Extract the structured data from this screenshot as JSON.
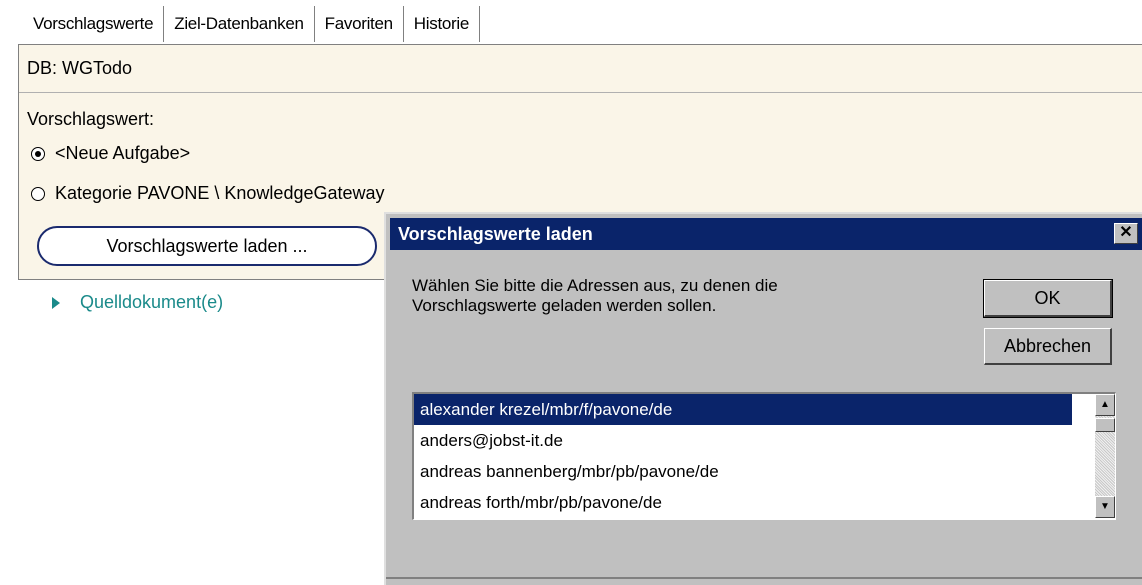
{
  "tabs": [
    "Vorschlagswerte",
    "Ziel-Datenbanken",
    "Favoriten",
    "Historie"
  ],
  "panel": {
    "db_label": "DB: WGTodo",
    "vorschlagswert_label": "Vorschlagswert:",
    "radio_options": [
      "<Neue Aufgabe>",
      "Kategorie PAVONE \\ KnowledgeGateway"
    ],
    "selected_option": "<Neue Aufgabe>",
    "load_button": "Vorschlagswerte laden ..."
  },
  "quell_link": "Quelldokument(e)",
  "dialog": {
    "title": "Vorschlagswerte laden",
    "close_glyph": "✕",
    "message_line1": "Wählen Sie bitte die Adressen aus, zu denen die",
    "message_line2": "Vorschlagswerte geladen werden sollen.",
    "ok_label": "OK",
    "cancel_label": "Abbrechen",
    "list_items": [
      "alexander krezel/mbr/f/pavone/de",
      "anders@jobst-it.de",
      "andreas bannenberg/mbr/pb/pavone/de",
      "andreas forth/mbr/pb/pavone/de"
    ],
    "selected_item": "alexander krezel/mbr/f/pavone/de"
  },
  "colors": {
    "panel_bg": "#faf5e8",
    "titlebar_bg": "#0a246a",
    "link_color": "#1a8a8a",
    "dialog_bg": "#c0c0c0"
  }
}
